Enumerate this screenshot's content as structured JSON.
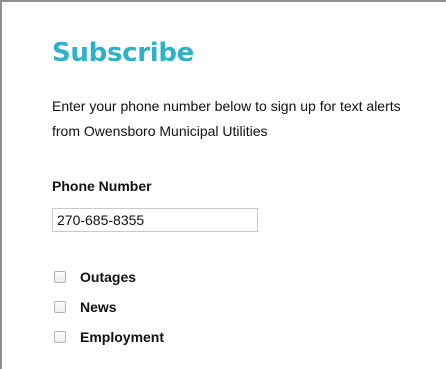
{
  "form": {
    "title": "Subscribe",
    "description": "Enter your phone number below to sign up for text alerts from Owensboro Municipal Utilities",
    "phone_label": "Phone Number",
    "phone_value": "270-685-8355",
    "options": [
      {
        "label": "Outages",
        "checked": false
      },
      {
        "label": "News",
        "checked": false
      },
      {
        "label": "Employment",
        "checked": false
      }
    ]
  },
  "colors": {
    "accent": "#2fb1c9",
    "text": "#111111",
    "border": "#8f8f8f"
  }
}
